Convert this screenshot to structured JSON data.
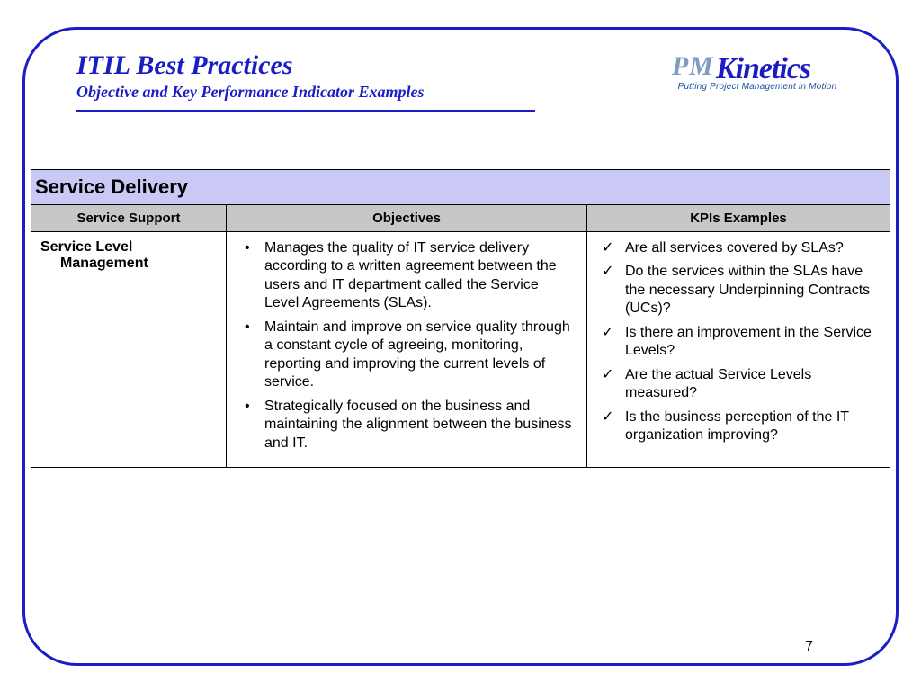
{
  "header": {
    "title": "ITIL Best Practices",
    "subtitle": "Objective and Key Performance Indicator Examples"
  },
  "logo": {
    "pm": "PM",
    "brand": "Kinetics",
    "tagline": "Putting Project Management in Motion"
  },
  "table": {
    "section_title": "Service Delivery",
    "columns": {
      "support": "Service Support",
      "objectives": "Objectives",
      "kpis": "KPIs Examples"
    },
    "row": {
      "head_main": "Service Level",
      "head_sub": "Management",
      "objectives": [
        "Manages the quality of IT service delivery according to a written agreement between the users and IT department called the Service Level Agreements (SLAs).",
        "Maintain and improve on service quality through a constant cycle of agreeing, monitoring, reporting and improving the current levels of service.",
        "Strategically focused on the business and maintaining the alignment between the business and IT."
      ],
      "kpis": [
        "Are all services covered by SLAs?",
        "Do the services within the SLAs have the necessary Underpinning Contracts (UCs)?",
        "Is there an improvement in the Service Levels?",
        "Are the actual Service Levels measured?",
        "Is the business perception of the IT organization improving?"
      ]
    }
  },
  "page_number": "7"
}
